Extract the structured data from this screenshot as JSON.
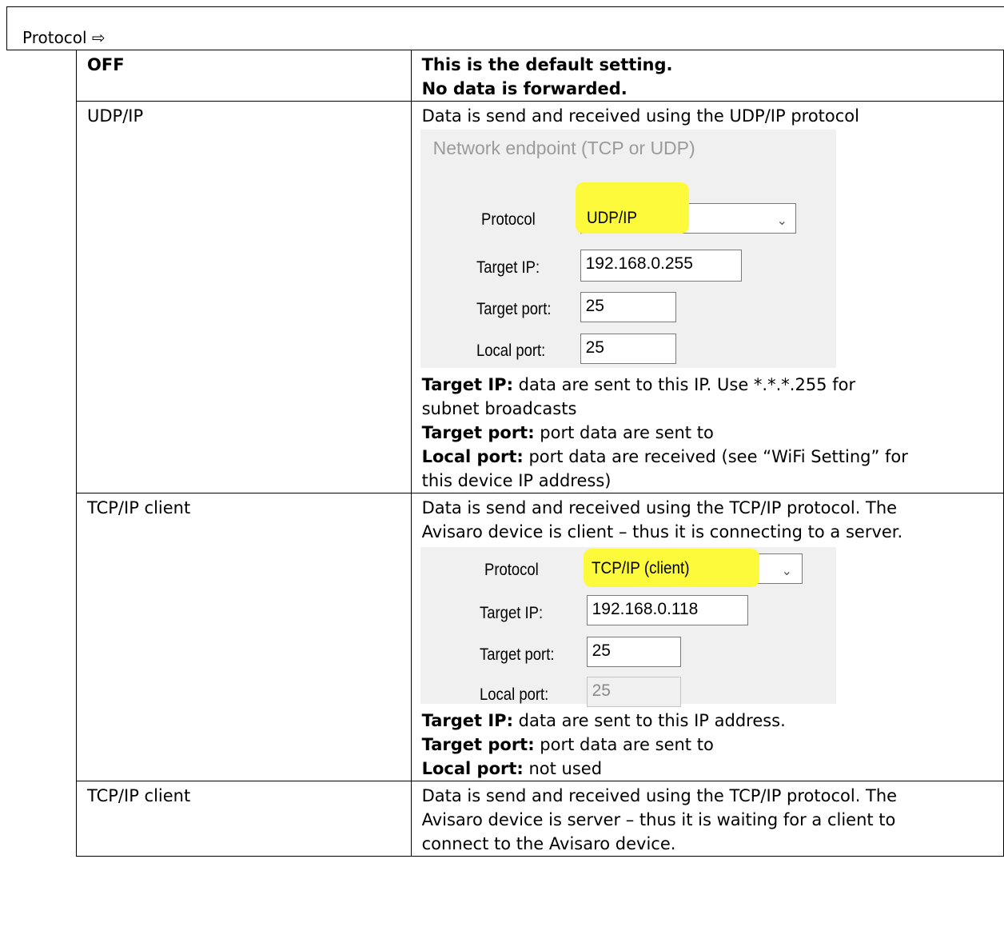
{
  "heading": "Protocol ⇨",
  "rows": [
    {
      "name": "OFF",
      "desc_lines": [
        "This is the default setting.",
        "No data is forwarded."
      ]
    },
    {
      "name": "UDP/IP",
      "desc_intro": "Data is send and received using the UDP/IP protocol",
      "notes": [
        {
          "label": "Target IP:",
          "text": " data are sent to this IP. Use *.*.*.255 for"
        },
        {
          "label": "",
          "text": "subnet broadcasts"
        },
        {
          "label": "Target port:",
          "text": " port data are sent to"
        },
        {
          "label": "Local port:",
          "text": " port data are received (see “WiFi Setting” for"
        },
        {
          "label": "",
          "text": "this device IP address)"
        }
      ]
    },
    {
      "name": "TCP/IP client",
      "desc_lines": [
        "Data is send and received using the TCP/IP protocol. The",
        "Avisaro device is client – thus it is connecting to a server."
      ],
      "notes": [
        {
          "label": "Target IP:",
          "text": " data are sent to this IP address."
        },
        {
          "label": "Target port:",
          "text": " port data are sent to"
        },
        {
          "label": "Local port:",
          "text": " not used"
        }
      ]
    },
    {
      "name": "TCP/IP client",
      "desc_lines": [
        "Data is send and received using the TCP/IP protocol. The",
        "Avisaro device is server – thus it is waiting for a client to",
        "connect to the Avisaro device."
      ]
    }
  ],
  "udp_form": {
    "group_title": "Network endpoint (TCP or UDP)",
    "protocol_label": "Protocol",
    "protocol_value": "UDP/IP",
    "target_ip_label": "Target IP:",
    "target_ip": "192.168.0.255",
    "target_port_label": "Target port:",
    "target_port": "25",
    "local_port_label": "Local port:",
    "local_port": "25"
  },
  "tcp_form": {
    "protocol_label": "Protocol",
    "protocol_value": "TCP/IP (client)",
    "target_ip_label": "Target IP:",
    "target_ip": "192.168.0.118",
    "target_port_label": "Target port:",
    "target_port": "25",
    "local_port_label": "Local port:",
    "local_port": "25"
  },
  "colors": {
    "highlight": "#fdfa3c",
    "dialog_bg": "#f0f0f0",
    "group_title": "#9b9b9b"
  },
  "icons": {
    "dropdown": "chevron-down-icon"
  }
}
